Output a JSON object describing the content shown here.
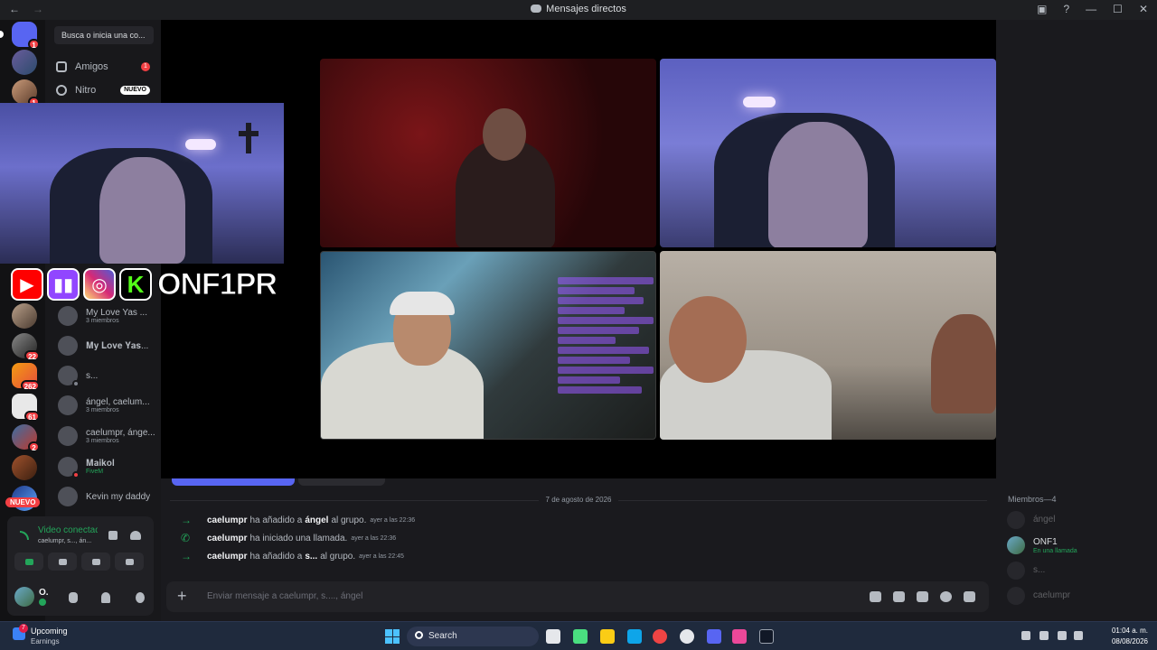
{
  "window": {
    "title": "Mensajes directos",
    "back_glyph": "←",
    "forward_glyph": "→",
    "inbox_glyph": "▣",
    "help_glyph": "?",
    "min_glyph": "—",
    "max_glyph": "☐",
    "close_glyph": "✕"
  },
  "rail": {
    "badges": [
      "1",
      "1",
      "22",
      "262",
      "61",
      "2"
    ],
    "new_badge": "NUEVO"
  },
  "sidebar": {
    "search_placeholder": "Busca o inicia una co...",
    "nav": [
      {
        "label": "Amigos",
        "count": "1"
      },
      {
        "label": "Nitro",
        "badge": "NUEVO"
      }
    ],
    "dms": [
      {
        "name": "My Love Yas ...",
        "sub": "3 miembros"
      },
      {
        "name": "𝐌𝐲 𝐋𝐨𝐯𝐞 𝐘𝐚𝐬...",
        "sub": ""
      },
      {
        "name": "s...",
        "sub": ""
      },
      {
        "name": "ángel, caelum...",
        "sub": "3 miembros"
      },
      {
        "name": "caelumpr, ánge...",
        "sub": "3 miembros"
      },
      {
        "name": "𝐌𝐚𝐢𝐤𝐨𝐥",
        "sub": "FiveM"
      },
      {
        "name": "Kevin my daddy",
        "sub": ""
      }
    ]
  },
  "voice": {
    "title": "Video conectado",
    "subtitle": "caelumpr, s..., án...",
    "user_name": "O."
  },
  "stream_overlay": {
    "brand": "ONF1PR",
    "kick_letter": "K"
  },
  "chat": {
    "date_divider": "7 de agosto de 2026",
    "messages": [
      {
        "icon": "→",
        "user": "caelumpr",
        "text_before": "ha añadido a",
        "subject": "ángel",
        "text_after": "al grupo.",
        "time": "ayer a las 22:36"
      },
      {
        "icon": "✆",
        "user": "caelumpr",
        "text_before": "ha iniciado una llamada.",
        "subject": "",
        "text_after": "",
        "time": "ayer a las 22:36"
      },
      {
        "icon": "→",
        "user": "caelumpr",
        "text_before": "ha añadido a",
        "subject": "s...",
        "text_after": "al grupo.",
        "time": "ayer a las 22:45"
      }
    ],
    "composer_placeholder": "Enviar mensaje a caelumpr, s...., ángel",
    "plus_glyph": "+"
  },
  "members": {
    "header": "Miembros—4",
    "list": [
      {
        "name": "ángel",
        "status": "",
        "online": false
      },
      {
        "name": "ONF1",
        "status": "En una llamada",
        "online": true
      },
      {
        "name": "s...",
        "status": "",
        "online": false
      },
      {
        "name": "caelumpr",
        "status": "",
        "online": false
      }
    ]
  },
  "taskbar": {
    "widget_title": "Upcoming",
    "widget_sub": "Earnings",
    "widget_badge": "7",
    "search_label": "Search",
    "time": "01:04 a. m.",
    "date": "08/08/2026"
  }
}
